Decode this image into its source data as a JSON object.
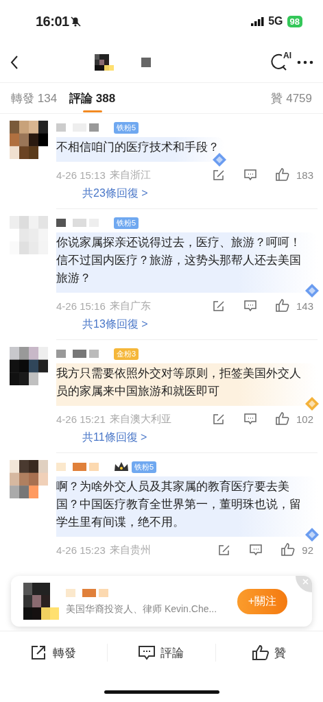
{
  "status_bar": {
    "time": "16:01",
    "network": "5G",
    "battery": "98"
  },
  "nav": {
    "ai_label": "AI"
  },
  "tabs": [
    {
      "label": "轉發 134",
      "selected": false
    },
    {
      "label": "評論 388",
      "selected": true
    }
  ],
  "likes_tab": "贊 4759",
  "comments": [
    {
      "badge": {
        "text": "铁粉5",
        "kind": "iron"
      },
      "crown": false,
      "kind": "blue",
      "text": "不相信咱门的医疗技术和手段？",
      "time": "4-26 15:13",
      "location": "来自浙江",
      "likes": "183",
      "replies": "共23條回復 >"
    },
    {
      "badge": {
        "text": "铁粉5",
        "kind": "iron"
      },
      "crown": false,
      "kind": "blue",
      "text": "你说家属探亲还说得过去，医疗、旅游？呵呵！信不过国内医疗？旅游，这势头那帮人还去美国旅游？",
      "time": "4-26 15:16",
      "location": "来自广东",
      "likes": "143",
      "replies": "共13條回復 >"
    },
    {
      "badge": {
        "text": "金粉3",
        "kind": "gold"
      },
      "crown": false,
      "kind": "gold",
      "text": "我方只需要依照外交对等原则，拒签美国外交人员的家属来中国旅游和就医即可",
      "time": "4-26 15:21",
      "location": "来自澳大利亚",
      "likes": "102",
      "replies": "共11條回復 >"
    },
    {
      "badge": {
        "text": "铁粉5",
        "kind": "iron"
      },
      "crown": true,
      "kind": "blue",
      "text": "啊？为啥外交人员及其家属的教育医疗要去美国？中国医疗教育全世界第一，董明珠也说，留学生里有间谍，绝不用。",
      "time": "4-26 15:23",
      "location": "来自贵州",
      "likes": "92"
    }
  ],
  "follow_card": {
    "description": "美国华裔投资人、律师 Kevin.Che...",
    "button": "+關注"
  },
  "bottom_bar": [
    {
      "kind": "repost",
      "label": "轉發"
    },
    {
      "kind": "comment",
      "label": "評論"
    },
    {
      "kind": "like",
      "label": "贊"
    }
  ]
}
